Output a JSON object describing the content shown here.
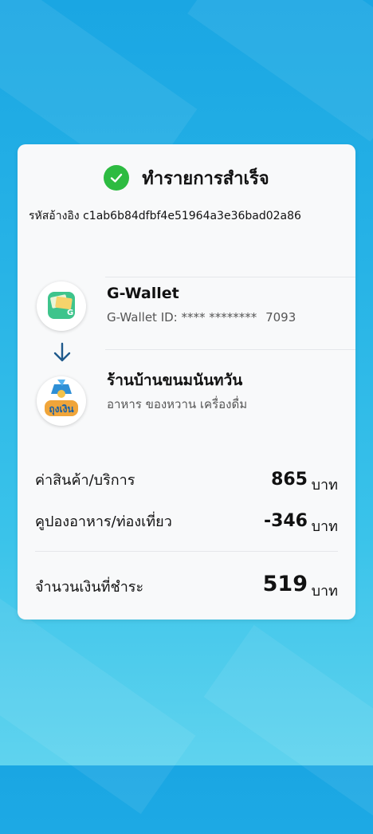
{
  "receipt": {
    "status_title": "ทำรายการสำเร็จ",
    "reference_label": "รหัสอ้างอิง",
    "reference_code": "c1ab6b84dfbf4e51964a3e36bad02a86"
  },
  "payer": {
    "name": "G-Wallet",
    "id_label": "G-Wallet ID:",
    "id_masked": "**** ********",
    "id_last4": "7093",
    "logo_text": "G",
    "icon": "g-wallet-logo-icon"
  },
  "payee": {
    "name": "ร้านบ้านขนมนันทวัน",
    "category": "อาหาร ของหวาน เครื่องดื่ม",
    "logo_text": "ถุงเงิน",
    "icon": "thung-ngoen-logo-icon"
  },
  "summary": {
    "items": [
      {
        "label": "ค่าสินค้า/บริการ",
        "amount": "865",
        "unit": "บาท"
      },
      {
        "label": "คูปองอาหาร/ท่องเที่ยว",
        "amount": "-346",
        "unit": "บาท"
      }
    ],
    "total": {
      "label": "จำนวนเงินที่ชำระ",
      "amount": "519",
      "unit": "บาท"
    }
  },
  "colors": {
    "success_green": "#2dbb41",
    "arrow_blue": "#1f5a8c",
    "background_top": "#1aa6e3",
    "background_bottom": "#5fd3ee"
  }
}
